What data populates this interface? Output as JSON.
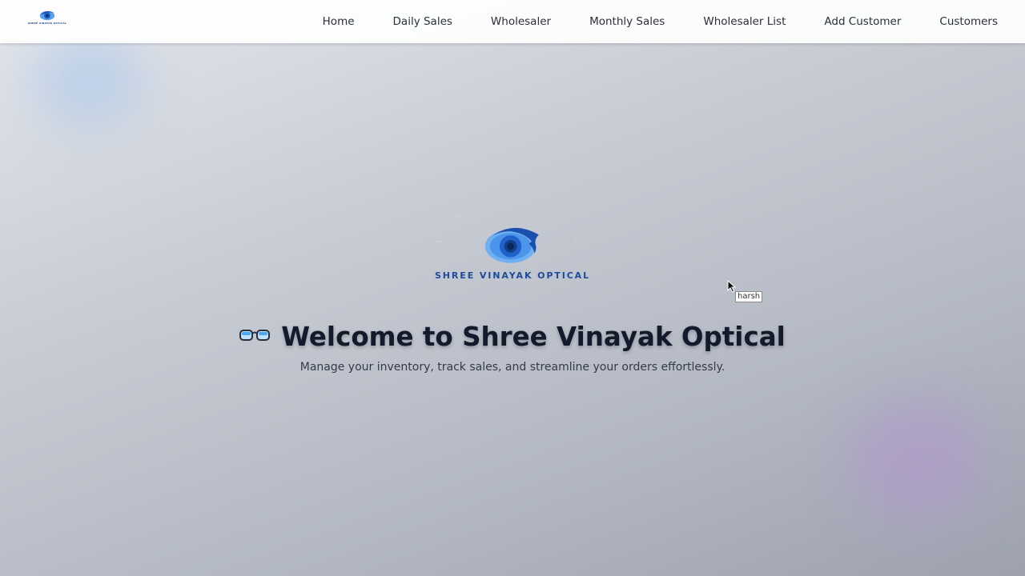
{
  "navbar": {
    "logo_text": "SHREE VINAYAK OPTICAL",
    "links": [
      {
        "label": "Home"
      },
      {
        "label": "Daily Sales"
      },
      {
        "label": "Wholesaler"
      },
      {
        "label": "Monthly Sales"
      },
      {
        "label": "Wholesaler List"
      },
      {
        "label": "Add Customer"
      },
      {
        "label": "Customers"
      }
    ]
  },
  "hero": {
    "logo_text": "SHREE VINAYAK OPTICAL",
    "title": "Welcome to Shree Vinayak Optical",
    "subtitle": "Manage your inventory, track sales, and streamline your orders effortlessly.",
    "glasses_icon": "glasses-icon"
  },
  "tooltip": {
    "text": "harsh"
  },
  "colors": {
    "brand_blue": "#1d4b9c",
    "eye_blue": "#2e7ae0",
    "title_text": "#141a2b"
  }
}
